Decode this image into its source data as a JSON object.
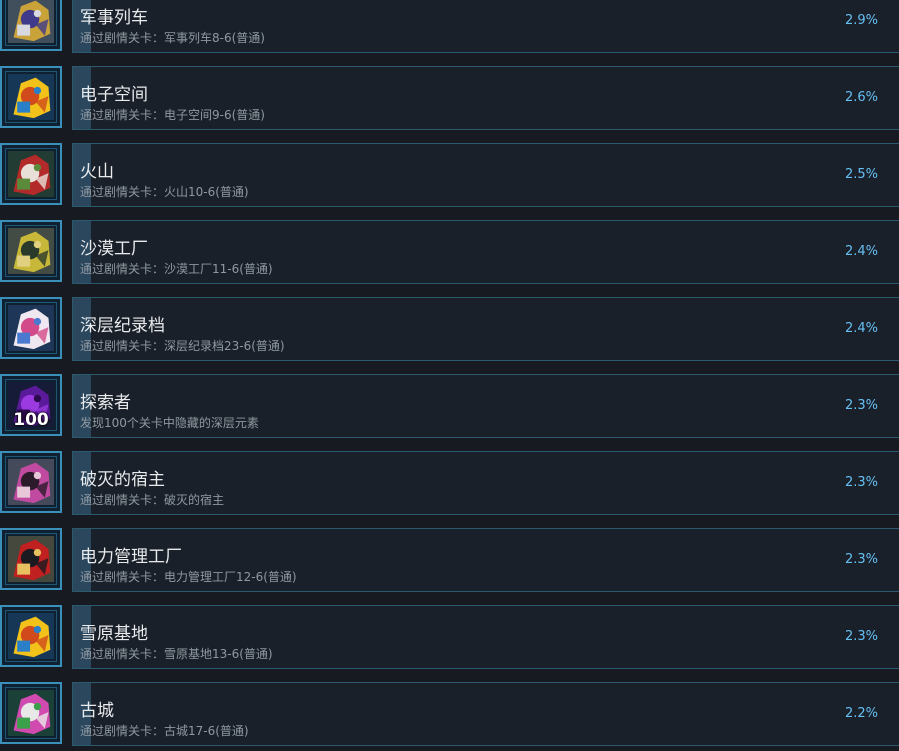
{
  "achievements": [
    {
      "title": "军事列车",
      "desc": "通过剧情关卡：军事列车8-6(普通)",
      "pct": "2.9%",
      "icon": "military-train-robot-icon",
      "colors": [
        "#c9a33a",
        "#3f3a8a",
        "#d8d8e0"
      ]
    },
    {
      "title": "电子空间",
      "desc": "通过剧情关卡：电子空间9-6(普通)",
      "pct": "2.6%",
      "icon": "cyberspace-robot-icon",
      "colors": [
        "#f2c21b",
        "#d04a1c",
        "#2a80c8"
      ]
    },
    {
      "title": "火山",
      "desc": "通过剧情关卡：火山10-6(普通)",
      "pct": "2.5%",
      "icon": "volcano-robot-icon",
      "colors": [
        "#b32a2a",
        "#e8e0d8",
        "#5a8a3a"
      ]
    },
    {
      "title": "沙漠工厂",
      "desc": "通过剧情关卡：沙漠工厂11-6(普通)",
      "pct": "2.4%",
      "icon": "desert-factory-robot-icon",
      "colors": [
        "#c8b83a",
        "#2a3a2a",
        "#e0d080"
      ]
    },
    {
      "title": "深层纪录档",
      "desc": "通过剧情关卡：深层纪录档23-6(普通)",
      "pct": "2.4%",
      "icon": "deep-archive-girl-icon",
      "colors": [
        "#f0e8f0",
        "#d24a8a",
        "#4a7ad0"
      ]
    },
    {
      "title": "探索者",
      "desc": "发现100个关卡中隐藏的深层元素",
      "pct": "2.3%",
      "icon": "explorer-orb-icon",
      "colors": [
        "#5a1a9a",
        "#9a3ae0",
        "#2a0a4a"
      ],
      "count": "100"
    },
    {
      "title": "破灭的宿主",
      "desc": "通过剧情关卡：破灭的宿主",
      "pct": "2.3%",
      "icon": "ruined-host-girl-icon",
      "colors": [
        "#c04aa0",
        "#2a1a2a",
        "#e8c8d8"
      ]
    },
    {
      "title": "电力管理工厂",
      "desc": "通过剧情关卡：电力管理工厂12-6(普通)",
      "pct": "2.3%",
      "icon": "power-plant-robot-icon",
      "colors": [
        "#c02020",
        "#1a1a20",
        "#e8c060"
      ]
    },
    {
      "title": "雪原基地",
      "desc": "通过剧情关卡：雪原基地13-6(普通)",
      "pct": "2.3%",
      "icon": "snowfield-base-robot-icon",
      "colors": [
        "#f2c21b",
        "#d04a1c",
        "#2a80c8"
      ]
    },
    {
      "title": "古城",
      "desc": "通过剧情关卡：古城17-6(普通)",
      "pct": "2.2%",
      "icon": "ancient-city-robot-icon",
      "colors": [
        "#d04ab0",
        "#e8e8e8",
        "#3aa04a"
      ]
    }
  ]
}
